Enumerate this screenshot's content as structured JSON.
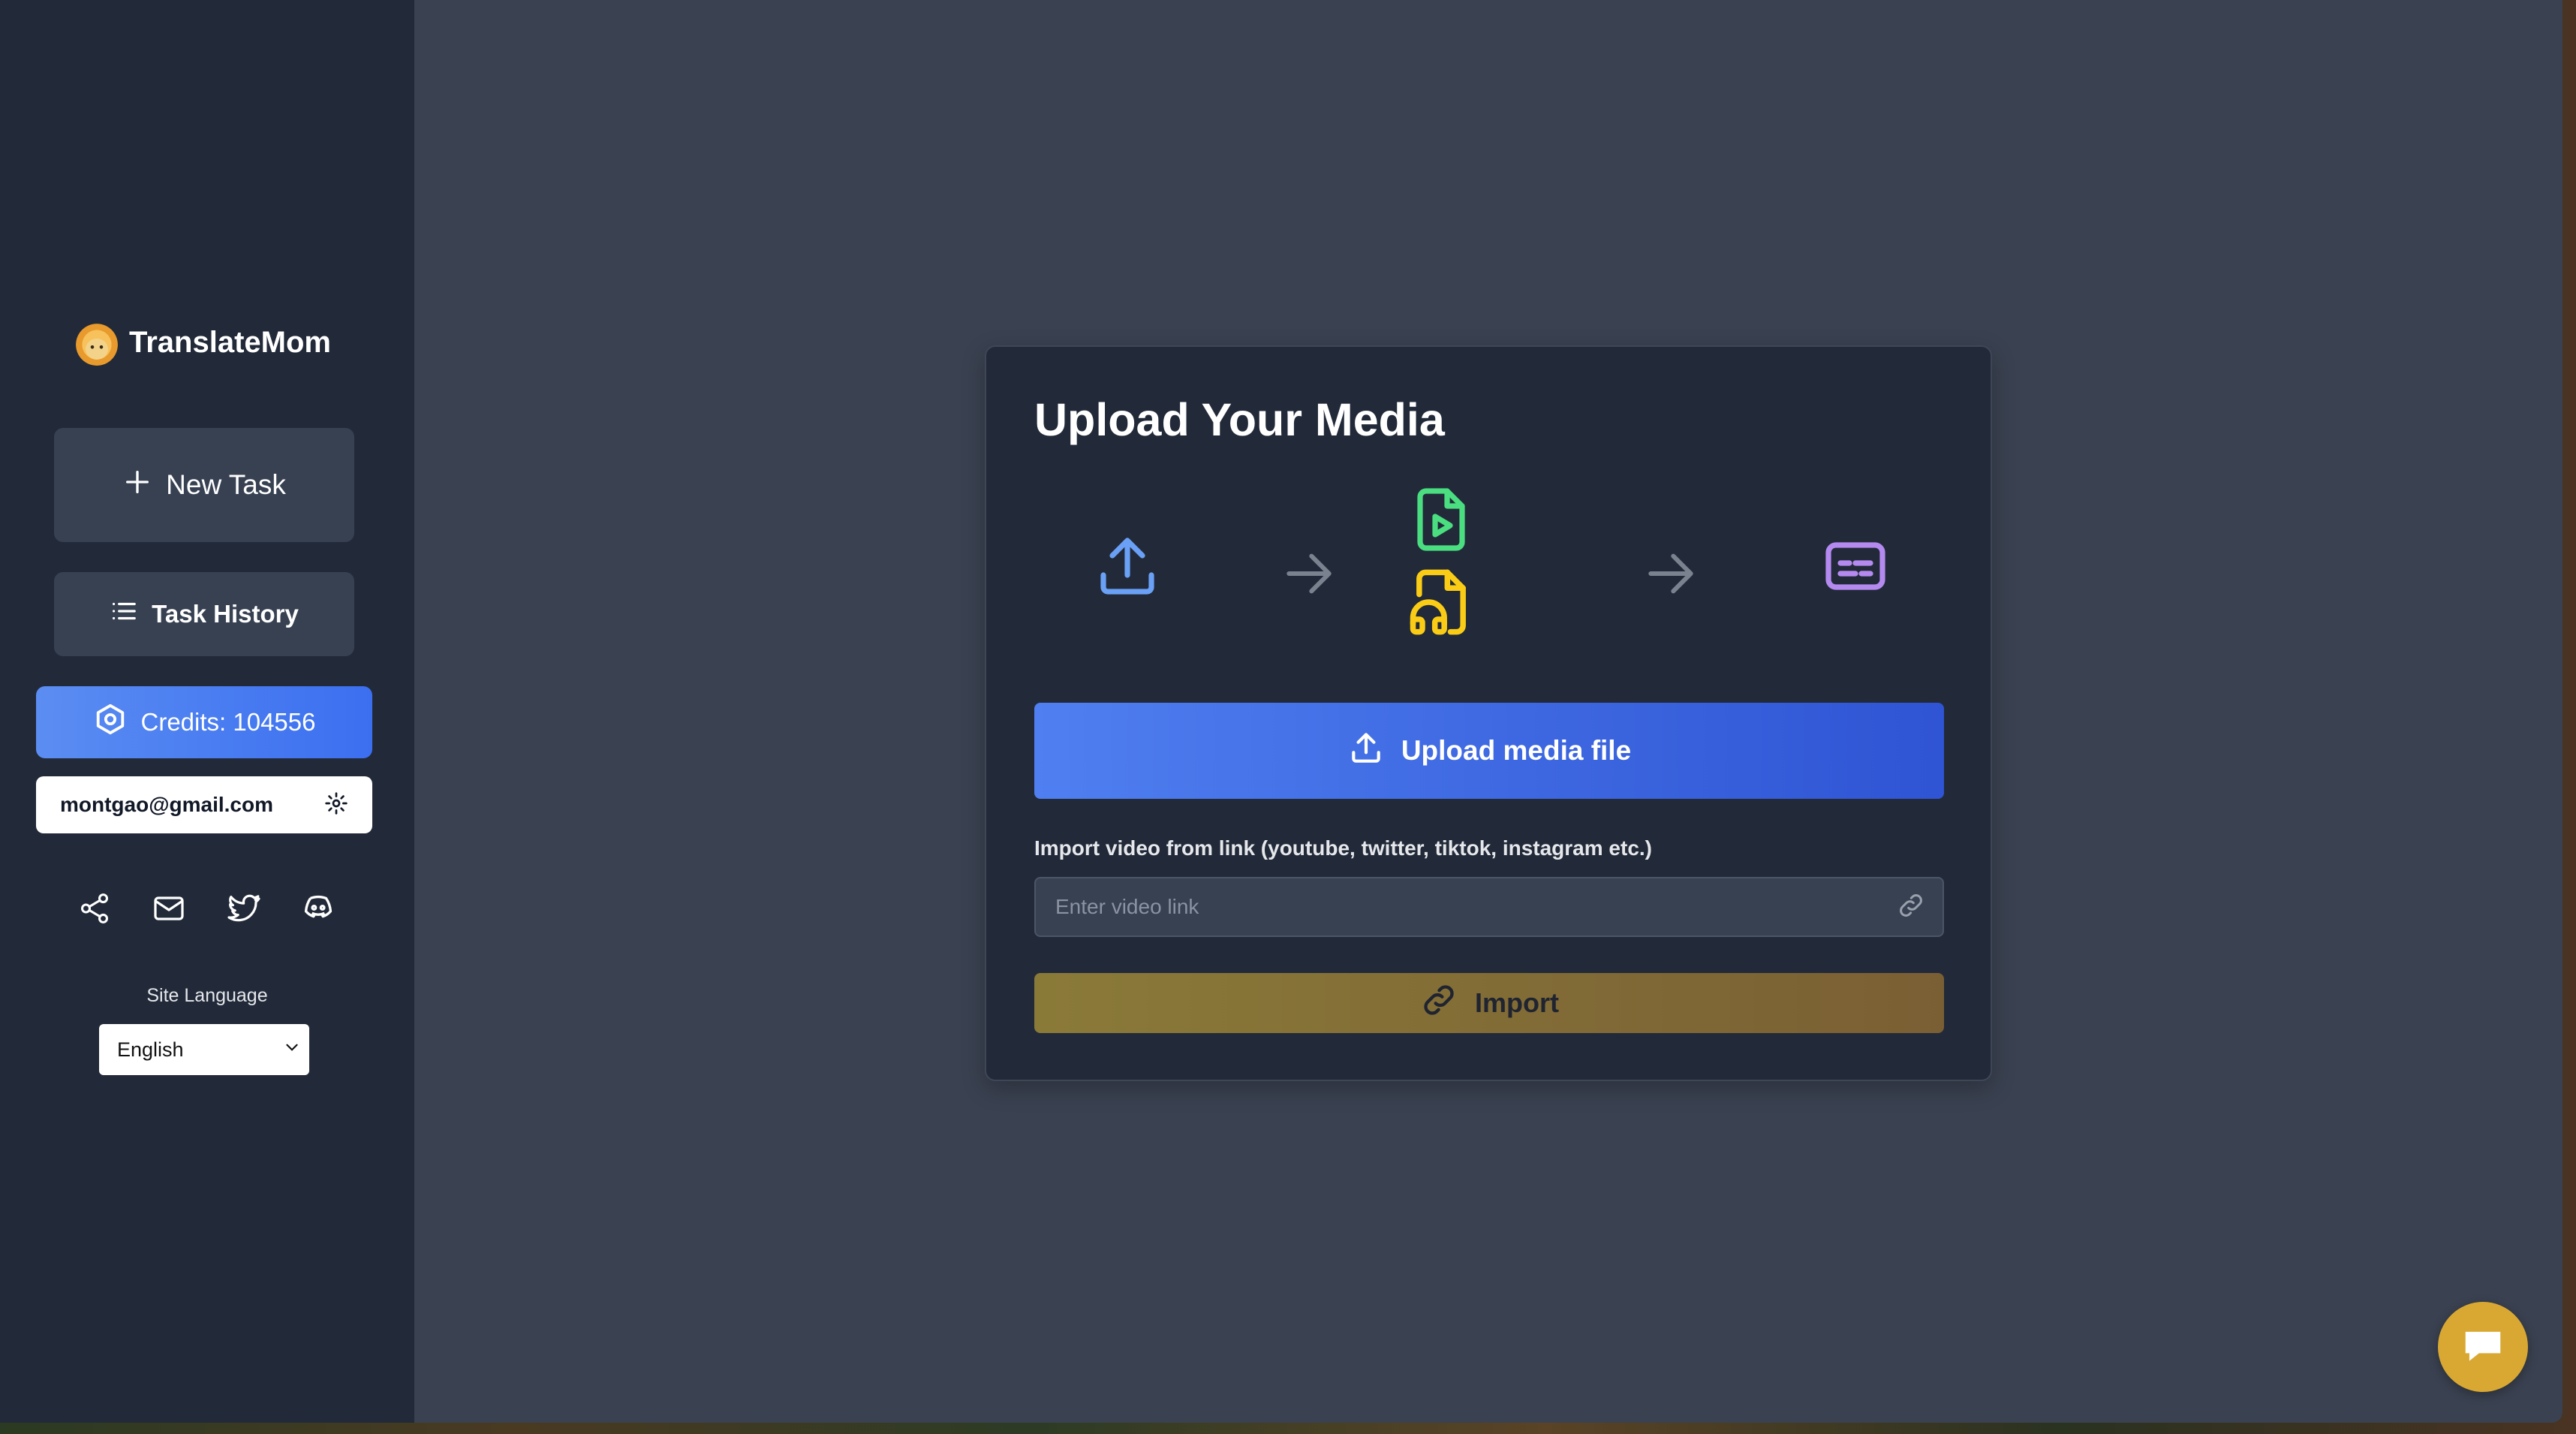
{
  "sidebar": {
    "brand_name": "TranslateMom",
    "new_task_label": "New Task",
    "task_history_label": "Task History",
    "credits_label": "Credits: 104556",
    "user_email": "montgao@gmail.com",
    "social_icons": [
      "share-icon",
      "mail-icon",
      "twitter-icon",
      "discord-icon"
    ],
    "site_language_label": "Site Language",
    "site_language_value": "English"
  },
  "main": {
    "card_title": "Upload Your Media",
    "flow_icons": [
      "upload-icon",
      "arrow-right-icon",
      "video-file-icon",
      "audio-file-icon",
      "arrow-right-icon",
      "subtitles-icon"
    ],
    "upload_button_label": "Upload media file",
    "import_label": "Import video from link (youtube, twitter, tiktok, instagram etc.)",
    "link_input_placeholder": "Enter video link",
    "link_input_value": "",
    "import_button_label": "Import"
  },
  "colors": {
    "sidebar_bg": "#222a39",
    "main_bg": "#3a4150",
    "card_bg": "#222a39",
    "upload_button": "#3b6ff0",
    "import_button": "#8a7a38",
    "credits_button": "#5b8df2",
    "upload_icon": "#6aa0f5",
    "video_icon": "#4ade80",
    "audio_icon": "#facc15",
    "subtitles_icon": "#b58af0",
    "chat_bubble": "#d9a832"
  },
  "chat_widget": "chat-icon"
}
